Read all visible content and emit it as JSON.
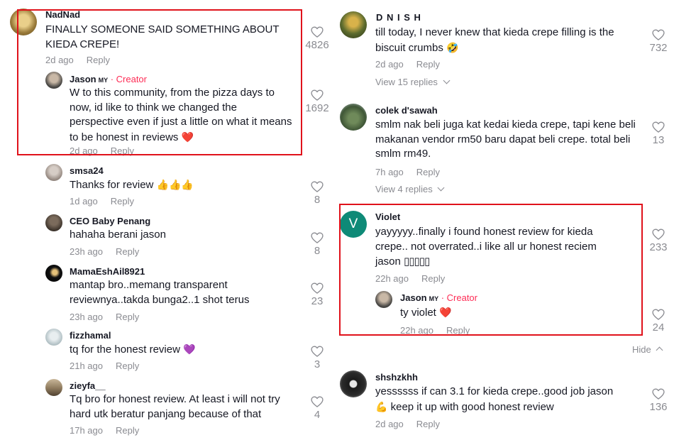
{
  "left": {
    "c1": {
      "name": "NadNad",
      "text": "FINALLY SOMEONE SAID SOMETHING ABOUT KIEDA CREPE!",
      "time": "2d ago",
      "reply": "Reply",
      "likes": "4826"
    },
    "c1r": {
      "name": "Jason",
      "tag": "MY",
      "creator": "· Creator",
      "text": "W to this community, from the pizza days to now, id like to think we changed the perspective even if just a little on what it means to be honest in reviews",
      "emoji": "❤️",
      "time": "2d ago",
      "reply": "Reply",
      "likes": "1692"
    },
    "c2": {
      "name": "smsa24",
      "text": "Thanks for review",
      "emoji": "👍👍👍",
      "time": "1d ago",
      "reply": "Reply",
      "likes": "8"
    },
    "c3": {
      "name": "CEO Baby Penang",
      "text": "hahaha berani jason",
      "time": "23h ago",
      "reply": "Reply",
      "likes": "8"
    },
    "c4": {
      "name": "MamaEshAil8921",
      "text": "mantap bro..memang transparent reviewnya..takda bunga2..1 shot terus",
      "time": "23h ago",
      "reply": "Reply",
      "likes": "23"
    },
    "c5": {
      "name": "fizzhamal",
      "text": "tq for the honest review",
      "emoji": "💜",
      "time": "21h ago",
      "reply": "Reply",
      "likes": "3"
    },
    "c6": {
      "name": "zieyfa__",
      "text": "Tq bro for honest review. At least i will not try hard utk beratur panjang because of that",
      "time": "17h ago",
      "reply": "Reply",
      "likes": "4"
    }
  },
  "right": {
    "c1": {
      "name": "D N I S H",
      "text": "till today, I never knew that kieda crepe filling is the biscuit crumbs",
      "emoji": "🤣",
      "time": "2d ago",
      "reply": "Reply",
      "likes": "732",
      "view": "View 15 replies"
    },
    "c2": {
      "name": "colek d'sawah",
      "text": "smlm nak beli juga kat kedai kieda crepe, tapi kene beli makanan vendor rm50 baru dapat beli crepe. total beli smlm rm49.",
      "time": "7h ago",
      "reply": "Reply",
      "likes": "13",
      "view": "View 4 replies"
    },
    "c3": {
      "name": "Violet",
      "avatar_letter": "V",
      "text": "yayyyyy..finally i found honest review for kieda crepe.. not overrated..i like all ur honest reciem jason",
      "boxes": "▯▯▯▯▯",
      "time": "22h ago",
      "reply": "Reply",
      "likes": "233"
    },
    "c3r": {
      "name": "Jason",
      "tag": "MY",
      "creator": "· Creator",
      "text": "ty violet",
      "emoji": "❤️",
      "time": "22h ago",
      "reply": "Reply",
      "likes": "24"
    },
    "hide": "Hide",
    "c4": {
      "name": "shshzkhh",
      "text": "yessssss if can 3.1 for kieda crepe..good job jason",
      "emoji": "💪",
      "text2": "keep it up with good honest review",
      "time": "2d ago",
      "reply": "Reply",
      "likes": "136"
    }
  },
  "colors": {
    "highlight": "#e0121b",
    "creator": "#fe2c55",
    "violet_avatar": "#0e8a77",
    "meta": "#8a8b91"
  }
}
